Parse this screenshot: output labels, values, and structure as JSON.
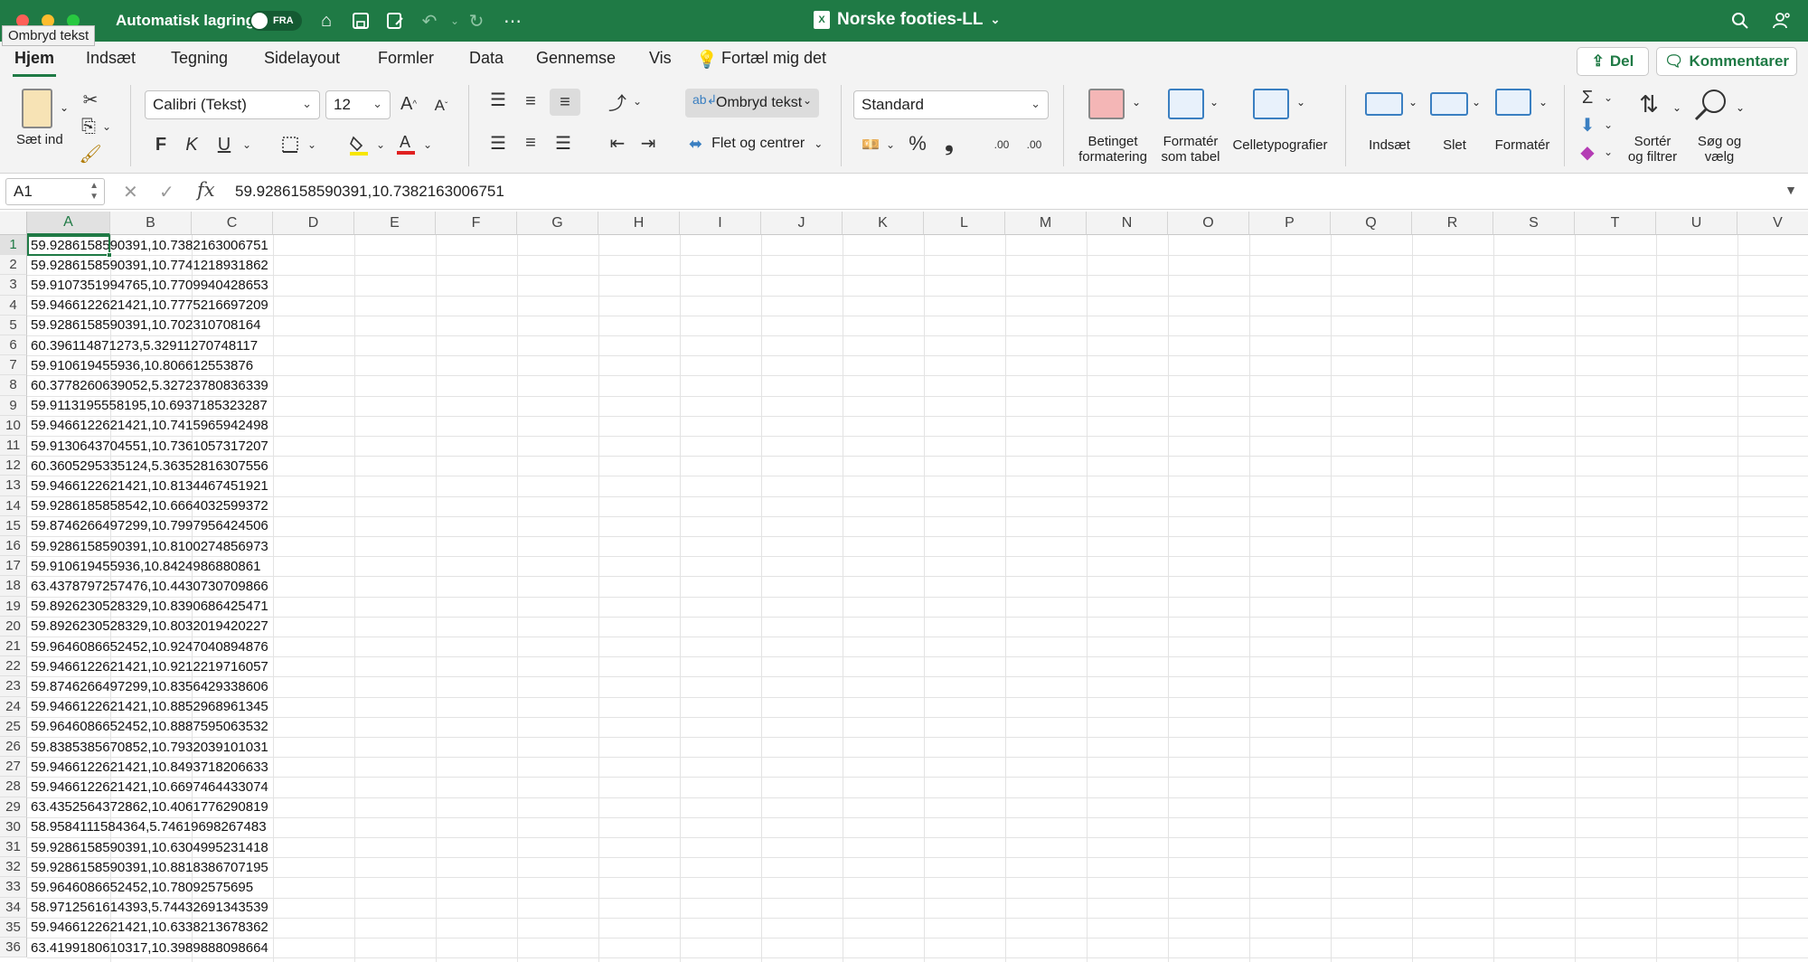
{
  "titlebar": {
    "autosave_label": "Automatisk lagring",
    "autosave_state": "FRA",
    "document_title": "Norske footies-LL",
    "doc_icon_letter": "X"
  },
  "tooltip": "Ombryd tekst",
  "tabs": [
    {
      "label": "Hjem",
      "active": true
    },
    {
      "label": "Indsæt"
    },
    {
      "label": "Tegning"
    },
    {
      "label": "Sidelayout"
    },
    {
      "label": "Formler"
    },
    {
      "label": "Data"
    },
    {
      "label": "Gennemse"
    },
    {
      "label": "Vis"
    },
    {
      "label": "Fortæl mig det"
    }
  ],
  "share_label": "Del",
  "comments_label": "Kommentarer",
  "ribbon": {
    "paste_label": "Sæt ind",
    "font_name": "Calibri (Tekst)",
    "font_size": "12",
    "bold": "F",
    "italic": "K",
    "underline": "U",
    "wrap_text": "Ombryd tekst",
    "merge_center": "Flet og centrer",
    "number_format": "Standard",
    "cond_format_1": "Betinget",
    "cond_format_2": "formatering",
    "format_table_1": "Formatér",
    "format_table_2": "som tabel",
    "cell_styles": "Celletypografier",
    "insert": "Indsæt",
    "delete": "Slet",
    "format": "Formatér",
    "sort_1": "Sortér",
    "sort_2": "og filtrer",
    "find_1": "Søg og",
    "find_2": "vælg",
    "percent": "%",
    "comma": "❟",
    "dec_inc": ".00",
    "dec_dec": ".00"
  },
  "formula_bar": {
    "name_box": "A1",
    "fx": "fx",
    "formula": "59.9286158590391,10.7382163006751"
  },
  "columns": [
    "A",
    "B",
    "C",
    "D",
    "E",
    "F",
    "G",
    "H",
    "I",
    "J",
    "K",
    "L",
    "M",
    "N",
    "O",
    "P",
    "Q",
    "R",
    "S",
    "T",
    "U",
    "V"
  ],
  "rows": [
    {
      "n": "1",
      "a": "59.9286158590391,10.7382163006751"
    },
    {
      "n": "2",
      "a": "59.9286158590391,10.7741218931862"
    },
    {
      "n": "3",
      "a": "59.9107351994765,10.7709940428653"
    },
    {
      "n": "4",
      "a": "59.9466122621421,10.7775216697209"
    },
    {
      "n": "5",
      "a": "59.9286158590391,10.702310708164"
    },
    {
      "n": "6",
      "a": "60.396114871273,5.32911270748117"
    },
    {
      "n": "7",
      "a": "59.910619455936,10.806612553876"
    },
    {
      "n": "8",
      "a": "60.3778260639052,5.32723780836339"
    },
    {
      "n": "9",
      "a": "59.9113195558195,10.6937185323287"
    },
    {
      "n": "10",
      "a": "59.9466122621421,10.7415965942498"
    },
    {
      "n": "11",
      "a": "59.9130643704551,10.7361057317207"
    },
    {
      "n": "12",
      "a": "60.3605295335124,5.36352816307556"
    },
    {
      "n": "13",
      "a": "59.9466122621421,10.8134467451921"
    },
    {
      "n": "14",
      "a": "59.9286185858542,10.6664032599372"
    },
    {
      "n": "15",
      "a": "59.8746266497299,10.7997956424506"
    },
    {
      "n": "16",
      "a": "59.9286158590391,10.8100274856973"
    },
    {
      "n": "17",
      "a": "59.910619455936,10.8424986880861"
    },
    {
      "n": "18",
      "a": "63.4378797257476,10.4430730709866"
    },
    {
      "n": "19",
      "a": "59.8926230528329,10.8390686425471"
    },
    {
      "n": "20",
      "a": "59.8926230528329,10.8032019420227"
    },
    {
      "n": "21",
      "a": "59.9646086652452,10.9247040894876"
    },
    {
      "n": "22",
      "a": "59.9466122621421,10.9212219716057"
    },
    {
      "n": "23",
      "a": "59.8746266497299,10.8356429338606"
    },
    {
      "n": "24",
      "a": "59.9466122621421,10.8852968961345"
    },
    {
      "n": "25",
      "a": "59.9646086652452,10.8887595063532"
    },
    {
      "n": "26",
      "a": "59.8385385670852,10.7932039101031"
    },
    {
      "n": "27",
      "a": "59.9466122621421,10.8493718206633"
    },
    {
      "n": "28",
      "a": "59.9466122621421,10.6697464433074"
    },
    {
      "n": "29",
      "a": "63.4352564372862,10.4061776290819"
    },
    {
      "n": "30",
      "a": "58.9584111584364,5.74619698267483"
    },
    {
      "n": "31",
      "a": "59.9286158590391,10.6304995231418"
    },
    {
      "n": "32",
      "a": "59.9286158590391,10.8818386707195"
    },
    {
      "n": "33",
      "a": "59.9646086652452,10.78092575695"
    },
    {
      "n": "34",
      "a": "58.9712561614393,5.74432691343539"
    },
    {
      "n": "35",
      "a": "59.9466122621421,10.6338213678362"
    },
    {
      "n": "36",
      "a": "63.4199180610317,10.3989888098664"
    }
  ]
}
